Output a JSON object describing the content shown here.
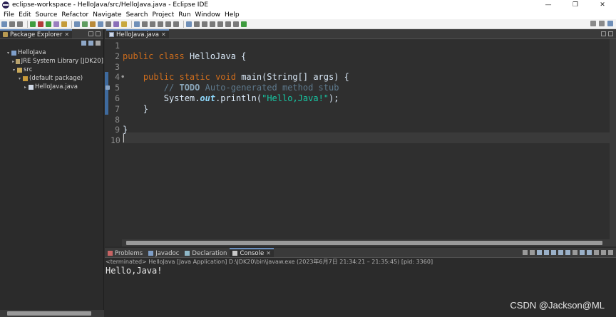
{
  "window": {
    "title": "eclipse-workspace - HelloJava/src/HelloJava.java - Eclipse IDE",
    "minimize": "—",
    "maximize": "❐",
    "close": "✕"
  },
  "menu": [
    "File",
    "Edit",
    "Source",
    "Refactor",
    "Navigate",
    "Search",
    "Project",
    "Run",
    "Window",
    "Help"
  ],
  "package_explorer": {
    "tab_label": "Package Explorer",
    "tree": [
      {
        "label": "HelloJava",
        "indent": 1,
        "icon": "project-icon",
        "twisty": "▾"
      },
      {
        "label": "JRE System Library [JDK20]",
        "indent": 2,
        "icon": "library-icon",
        "twisty": "▸"
      },
      {
        "label": "src",
        "indent": 2,
        "icon": "source-folder-icon",
        "twisty": "▾"
      },
      {
        "label": "(default package)",
        "indent": 3,
        "icon": "package-icon",
        "twisty": "▾"
      },
      {
        "label": "HelloJava.java",
        "indent": 4,
        "icon": "java-file-icon",
        "twisty": "▸"
      }
    ]
  },
  "editor": {
    "tab_label": "HelloJava.java",
    "line_numbers": [
      "1",
      "2",
      "3",
      "4",
      "5",
      "6",
      "7",
      "8",
      "9",
      "10"
    ],
    "lines": [
      {
        "text": ""
      },
      {
        "tokens": [
          {
            "t": "public ",
            "c": "kw"
          },
          {
            "t": "class ",
            "c": "kw"
          },
          {
            "t": "HelloJava {",
            "c": "ty"
          }
        ]
      },
      {
        "text": ""
      },
      {
        "tokens": [
          {
            "t": "    ",
            "c": ""
          },
          {
            "t": "public ",
            "c": "kw"
          },
          {
            "t": "static ",
            "c": "kw"
          },
          {
            "t": "void ",
            "c": "kw"
          },
          {
            "t": "main(String[] args) {",
            "c": "fn"
          }
        ]
      },
      {
        "tokens": [
          {
            "t": "        // ",
            "c": "cm"
          },
          {
            "t": "TODO",
            "c": "todo"
          },
          {
            "t": " Auto-generated method stub",
            "c": "cm"
          }
        ]
      },
      {
        "tokens": [
          {
            "t": "        System.",
            "c": "ty"
          },
          {
            "t": "out",
            "c": "fld"
          },
          {
            "t": ".println(",
            "c": "ty"
          },
          {
            "t": "\"Hello,Java!\"",
            "c": "st"
          },
          {
            "t": ");",
            "c": "ty"
          }
        ]
      },
      {
        "tokens": [
          {
            "t": "    }",
            "c": "ty"
          }
        ]
      },
      {
        "text": ""
      },
      {
        "tokens": [
          {
            "t": "}",
            "c": "ty"
          }
        ]
      },
      {
        "text": ""
      }
    ]
  },
  "bottom_panel": {
    "tabs": [
      {
        "label": "Problems",
        "icon": "problems-icon",
        "active": false
      },
      {
        "label": "Javadoc",
        "icon": "javadoc-icon",
        "active": false
      },
      {
        "label": "Declaration",
        "icon": "declaration-icon",
        "active": false
      },
      {
        "label": "Console",
        "icon": "console-icon",
        "active": true
      }
    ],
    "status": "<terminated> HelloJava [Java Application] D:\\JDK20\\bin\\javaw.exe  (2023年6月7日 21:34:21 – 21:35:45) [pid: 3360]",
    "output": "Hello,Java!"
  },
  "watermark": "CSDN @Jackson@ML",
  "colors": {
    "keyword": "#cc6c1d",
    "string": "#17c6a3",
    "comment": "#5e7a8e",
    "field": "#8dd6f9"
  }
}
